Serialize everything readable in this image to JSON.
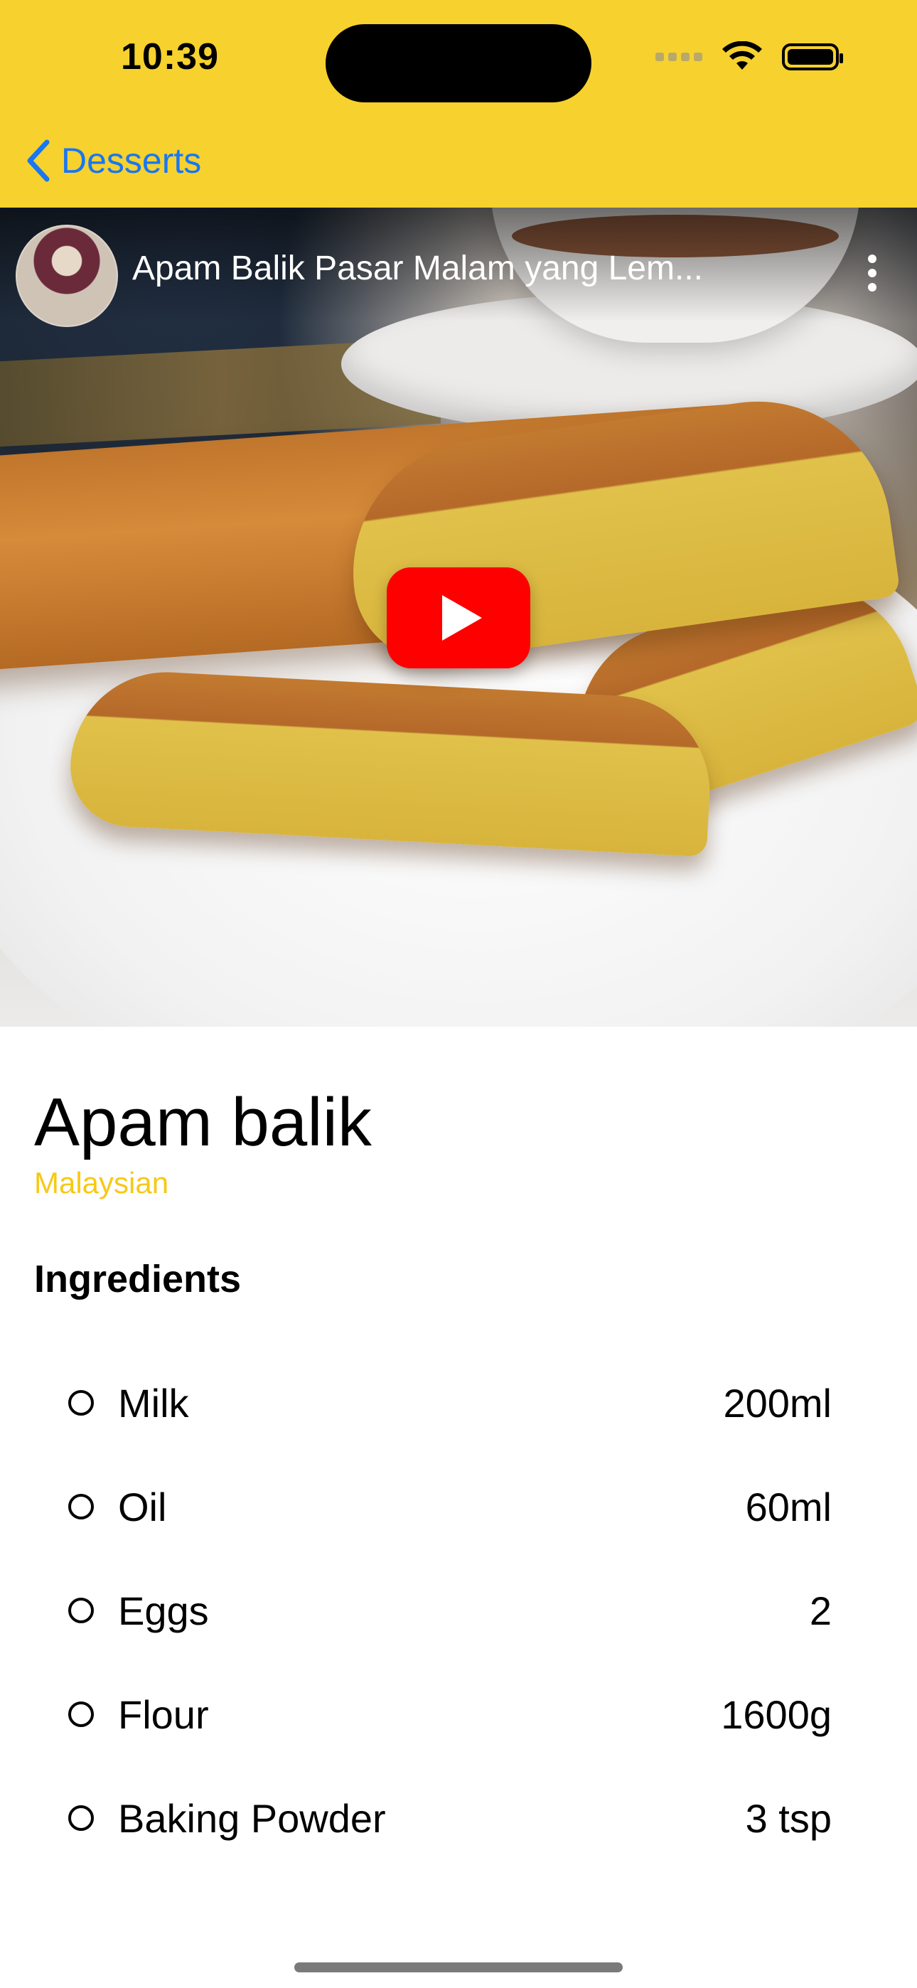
{
  "status_bar": {
    "time": "10:39"
  },
  "nav": {
    "back_label": "Desserts"
  },
  "video": {
    "title": "Apam Balik Pasar Malam yang Lem...",
    "play_icon": "youtube-play-icon",
    "more_icon": "more-vertical-icon"
  },
  "recipe": {
    "title": "Apam balik",
    "cuisine": "Malaysian",
    "section_title": "Ingredients",
    "ingredients": [
      {
        "name": "Milk",
        "amount": "200ml"
      },
      {
        "name": "Oil",
        "amount": "60ml"
      },
      {
        "name": "Eggs",
        "amount": "2"
      },
      {
        "name": "Flour",
        "amount": "1600g"
      },
      {
        "name": "Baking Powder",
        "amount": "3 tsp"
      }
    ]
  },
  "colors": {
    "header": "#F7D12D",
    "link": "#1877F2",
    "accent": "#F7C915",
    "play": "#FF0000"
  }
}
